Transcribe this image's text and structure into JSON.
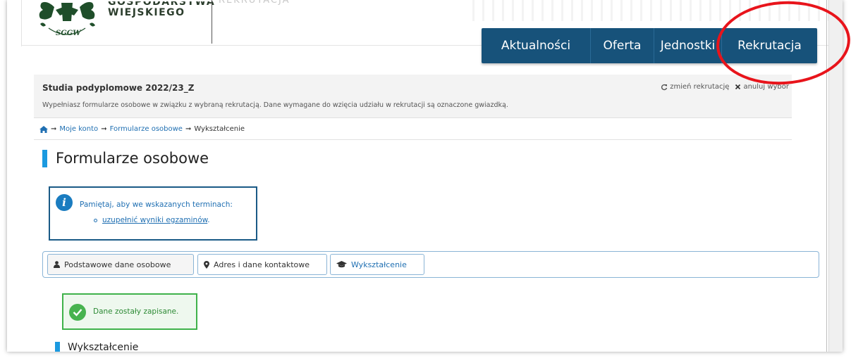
{
  "header": {
    "logo_line1": "GOSPODARSTWA",
    "logo_line2": "WIEJSKIEGO",
    "logo_badge": "SGGW",
    "faded_text": "REKRUTACJA"
  },
  "nav": {
    "items": [
      {
        "label": "Aktualności"
      },
      {
        "label": "Oferta"
      },
      {
        "label": "Jednostki"
      },
      {
        "label": "Rekrutacja"
      }
    ],
    "color": "#17527a"
  },
  "annotation": {
    "color": "#e8141b",
    "shape": "ellipse around Rekrutacja"
  },
  "info_panel": {
    "title": "Studia podyplomowe 2022/23_Z",
    "description": "Wypełniasz formularze osobowe w związku z wybraną rekrutacją. Dane wymagane do wzięcia udziału w rekrutacji są oznaczone gwiazdką.",
    "change_label": "zmień rekrutację",
    "cancel_label": "anuluj wybór"
  },
  "breadcrumb": {
    "home_icon": "home-icon",
    "items": [
      "Moje konto",
      "Formularze osobowe",
      "Wykształcenie"
    ]
  },
  "page": {
    "title": "Formularze osobowe",
    "accent": "#1b9ae0"
  },
  "notice": {
    "text": "Pamiętaj, aby we wskazanych terminach:",
    "link": "uzupełnić wyniki egzaminów",
    "link_suffix": "."
  },
  "tabs": [
    {
      "label": "Podstawowe dane osobowe",
      "icon": "user-icon"
    },
    {
      "label": "Adres i dane kontaktowe",
      "icon": "map-marker-icon"
    },
    {
      "label": "Wykształcenie",
      "icon": "graduation-cap-icon"
    }
  ],
  "success": {
    "text": "Dane zostały zapisane.",
    "color": "#3fb24a"
  },
  "section": {
    "title": "Wykształcenie"
  }
}
